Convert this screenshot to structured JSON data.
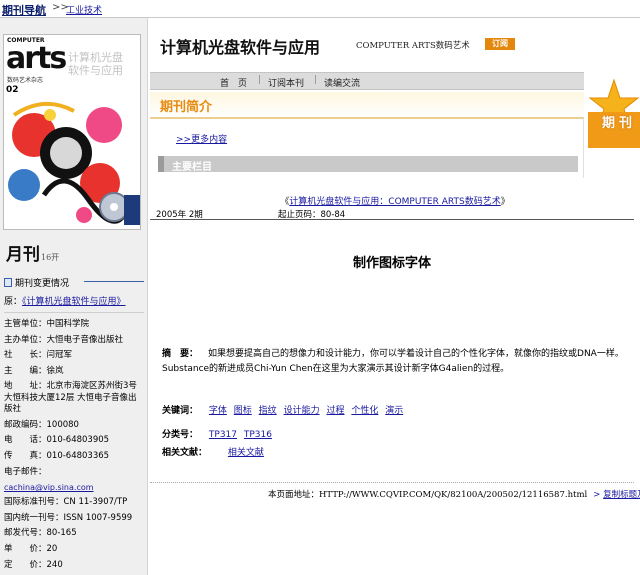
{
  "topbar": {
    "nav_title": "期刊导航",
    "separator": ">>",
    "crumb": "工业技术"
  },
  "cover": {
    "tag": "COMPUTER",
    "logo": "arts",
    "subtitle": "数码艺术杂志",
    "issue": "02",
    "ghost_text": "计算机光盘\n软件与应用"
  },
  "sidebar": {
    "monthly": "月刊",
    "format": "16开",
    "change_heading": "期刊变更情况",
    "former_label": "原：",
    "former_name": "《计算机光盘软件与应用》",
    "info": [
      "主管单位：中国科学院",
      "主办单位：大恒电子音像出版社",
      "社　　长：闫冠军",
      "主　　编：徐岚"
    ],
    "address": "地　　址：北京市海淀区苏州街3号 大恒科技大厦12层 大恒电子音像出版社",
    "info2": [
      "邮政编码：100080",
      "电　　话：010-64803905",
      "传　　真：010-64803365",
      "电子邮件："
    ],
    "email": "cachina@vip.sina.com",
    "info3": [
      "国际标准刊号：CN 11-3907/TP",
      "国内统一刊号：ISSN 1007-9599",
      "邮发代号：80-165",
      "单　　价：20",
      "定　　价：240"
    ]
  },
  "header": {
    "title": "计算机光盘软件与应用",
    "title_en": "COMPUTER ARTS数码艺术",
    "subscribe": "订阅"
  },
  "navbar": {
    "items": [
      "首　页",
      "订阅本刊",
      "读编交流"
    ]
  },
  "star": {
    "text": "期刊"
  },
  "intro": {
    "title": "期刊简介",
    "more": ">>更多内容",
    "columns_label": "主要栏目"
  },
  "article": {
    "journal_link": "计算机光盘软件与应用：COMPUTER ARTS数码艺术",
    "issue": "2005年 2期",
    "pages": "起止页码：80-84",
    "heading": "制作图标字体",
    "abstract_label": "摘　要：",
    "abstract": "如果想要提高自己的想像力和设计能力，你可以学着设计自己的个性化字体，就像你的指纹或DNA一样。Substance的新进成员Chi-Yun Chen在这里为大家演示其设计新字体G4alien的过程。",
    "keywords_label": "关键词：",
    "keywords": [
      "字体",
      "图标",
      "指纹",
      "设计能力",
      "过程",
      "个性化",
      "演示"
    ],
    "category_label": "分类号：",
    "categories": [
      "TP317",
      "TP316"
    ],
    "related_label": "相关文献：",
    "related_link": "相关文献"
  },
  "footer": {
    "url_label": "本页面地址：",
    "url": "HTTP://WWW.CQVIP.COM/QK/82100A/200502/12116587.html",
    "arrow": ">",
    "copy_link": "复制标题及链接"
  },
  "colors": {
    "accent": "#e78a10",
    "link": "#1a1aa0",
    "sidebar_bg": "#efefef"
  }
}
